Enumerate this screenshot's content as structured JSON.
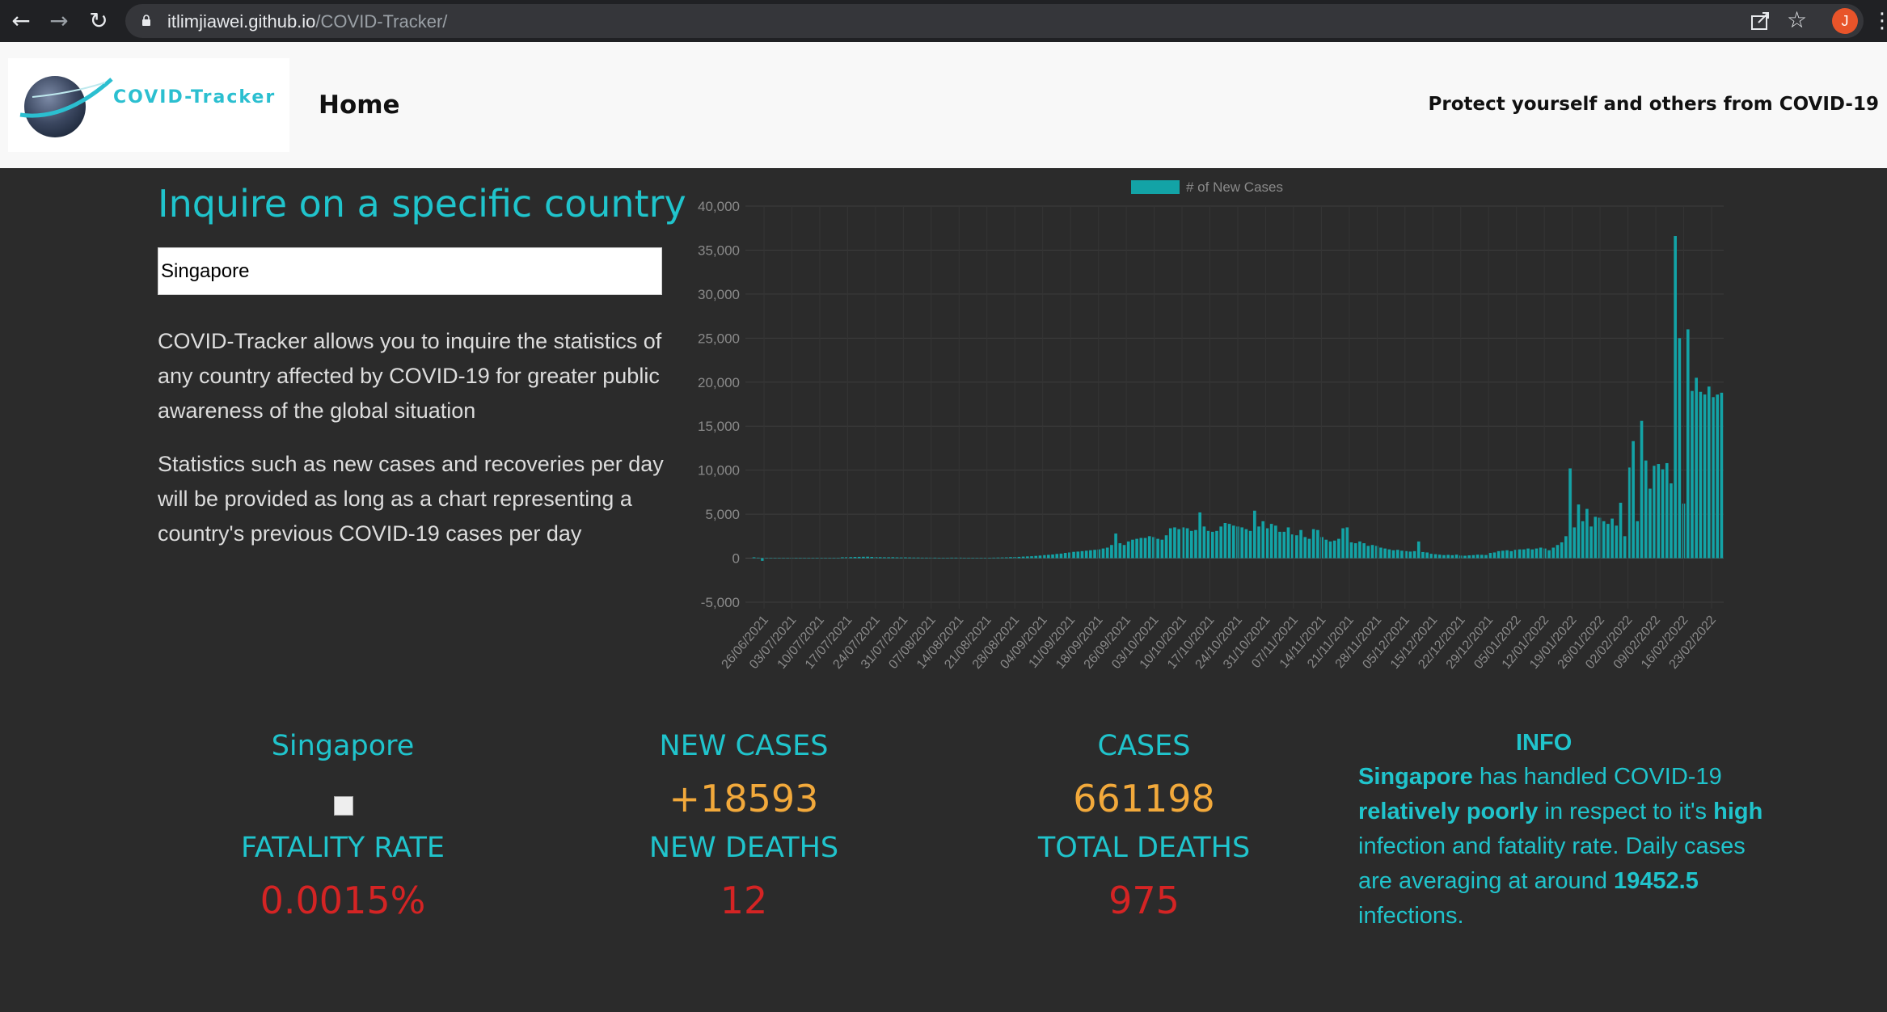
{
  "browser": {
    "url_host": "itlimjiawei.github.io",
    "url_path": "/COVID-Tracker/",
    "profile_initial": "J"
  },
  "header": {
    "logo_text": "COVID-Tracker",
    "nav_home": "Home",
    "tagline": "Protect yourself and others from COVID-19"
  },
  "inquire": {
    "title": "Inquire on a specific country",
    "input_value": "Singapore",
    "description_1": "COVID-Tracker allows you to inquire the statistics of any country affected by COVID-19 for greater public awareness of the global situation",
    "description_2": "Statistics such as new cases and recoveries per day will be provided as long as a chart representing a country's previous COVID-19 cases per day"
  },
  "chart_data": {
    "type": "bar",
    "legend": "# of New Cases",
    "legend_position": "top",
    "bar_color": "#13a3a6",
    "ylim": [
      -5000,
      40000
    ],
    "yticks": [
      40000,
      35000,
      30000,
      25000,
      20000,
      15000,
      10000,
      5000,
      0,
      -5000
    ],
    "ytick_labels": [
      "40,000",
      "35,000",
      "30,000",
      "25,000",
      "20,000",
      "15,000",
      "10,000",
      "5,000",
      "0",
      "-5,000"
    ],
    "xtick_labels": [
      "26/06/2021",
      "03/07/2021",
      "10/07/2021",
      "17/07/2021",
      "24/07/2021",
      "31/07/2021",
      "07/08/2021",
      "14/08/2021",
      "21/08/2021",
      "28/08/2021",
      "04/09/2021",
      "11/09/2021",
      "18/09/2021",
      "26/09/2021",
      "03/10/2021",
      "10/10/2021",
      "17/10/2021",
      "24/10/2021",
      "31/10/2021",
      "07/11/2021",
      "14/11/2021",
      "21/11/2021",
      "28/11/2021",
      "05/12/2021",
      "15/12/2021",
      "22/12/2021",
      "29/12/2021",
      "05/01/2022",
      "12/01/2022",
      "19/01/2022",
      "26/01/2022",
      "02/02/2022",
      "09/02/2022",
      "16/02/2022",
      "23/02/2022"
    ],
    "grid": true,
    "weekly_values": [
      [
        100,
        60,
        -300,
        40,
        30,
        20,
        10
      ],
      [
        20,
        30,
        20,
        20,
        30,
        30,
        30
      ],
      [
        40,
        50,
        40,
        40,
        30,
        50,
        40
      ],
      [
        100,
        110,
        120,
        140,
        150,
        160,
        170
      ],
      [
        140,
        120,
        110,
        100,
        100,
        110,
        90
      ],
      [
        80,
        90,
        80,
        70,
        70,
        60,
        60
      ],
      [
        60,
        60,
        50,
        50,
        50,
        60,
        60
      ],
      [
        60,
        50,
        50,
        50,
        40,
        40,
        50
      ],
      [
        50,
        60,
        70,
        80,
        90,
        120,
        140
      ],
      [
        150,
        180,
        200,
        220,
        260,
        300,
        350
      ],
      [
        380,
        420,
        480,
        520,
        600,
        650,
        720
      ],
      [
        750,
        800,
        850,
        900,
        950,
        1000,
        1100
      ],
      [
        1200,
        1500,
        2800,
        1700,
        1500,
        1900,
        2100
      ],
      [
        2200,
        2300,
        2300,
        2500,
        2400,
        2200,
        2100
      ],
      [
        2600,
        3400,
        3500,
        3300,
        3500,
        3400,
        3100
      ],
      [
        3200,
        5200,
        3600,
        3100,
        3000,
        3100,
        3600
      ],
      [
        4000,
        3900,
        3700,
        3600,
        3500,
        3300,
        3100
      ],
      [
        5400,
        3600,
        4200,
        3400,
        3900,
        3700,
        3000
      ],
      [
        3000,
        3500,
        2700,
        2600,
        3200,
        2400,
        2200
      ],
      [
        3300,
        3200,
        2400,
        2100,
        1900,
        2000,
        2200
      ],
      [
        3400,
        3500,
        1800,
        1700,
        1900,
        1700,
        1400
      ],
      [
        1500,
        1400,
        1200,
        1100,
        1000,
        900,
        950
      ],
      [
        850,
        800,
        750,
        800,
        1900,
        700,
        650
      ],
      [
        500,
        450,
        400,
        350,
        380,
        340,
        400
      ],
      [
        300,
        280,
        320,
        350,
        400,
        380,
        360
      ],
      [
        600,
        650,
        800,
        850,
        900,
        800,
        950
      ],
      [
        1000,
        1000,
        1100,
        1000,
        1100,
        1200,
        1100
      ],
      [
        900,
        1200,
        1500,
        1800,
        2500,
        10200,
        3500
      ],
      [
        6100,
        4200,
        5600,
        3600,
        4700,
        4600,
        4200
      ],
      [
        3900,
        4500,
        3700,
        6300,
        2500,
        10300,
        13300
      ],
      [
        4200,
        15600,
        11100,
        7900,
        10500,
        10700,
        10100
      ],
      [
        10800,
        8500,
        36600,
        25000,
        6200,
        26000,
        19000
      ],
      [
        20500,
        18900,
        18600,
        19500,
        18300,
        18593,
        18800
      ]
    ]
  },
  "stats": {
    "country": "Singapore",
    "new_cases_label": "NEW CASES",
    "new_cases": "+18593",
    "cases_label": "CASES",
    "cases": "661198",
    "fatality_rate_label": "FATALITY RATE",
    "fatality_rate": "0.0015%",
    "new_deaths_label": "NEW DEATHS",
    "new_deaths": "12",
    "total_deaths_label": "TOTAL DEATHS",
    "total_deaths": "975"
  },
  "info": {
    "title": "INFO",
    "country": "Singapore",
    "text_1": " has handled COVID-19 ",
    "rating": "relatively poorly",
    "text_2": " in respect to it's ",
    "level": "high",
    "text_3": " infection and fatality rate. Daily cases are averaging at around ",
    "average": "19452.5",
    "text_4": " infections."
  },
  "colors": {
    "accent": "#20c4cc",
    "value_orange": "#f2a93b",
    "value_red": "#d42424",
    "background": "#2b2b2b"
  }
}
